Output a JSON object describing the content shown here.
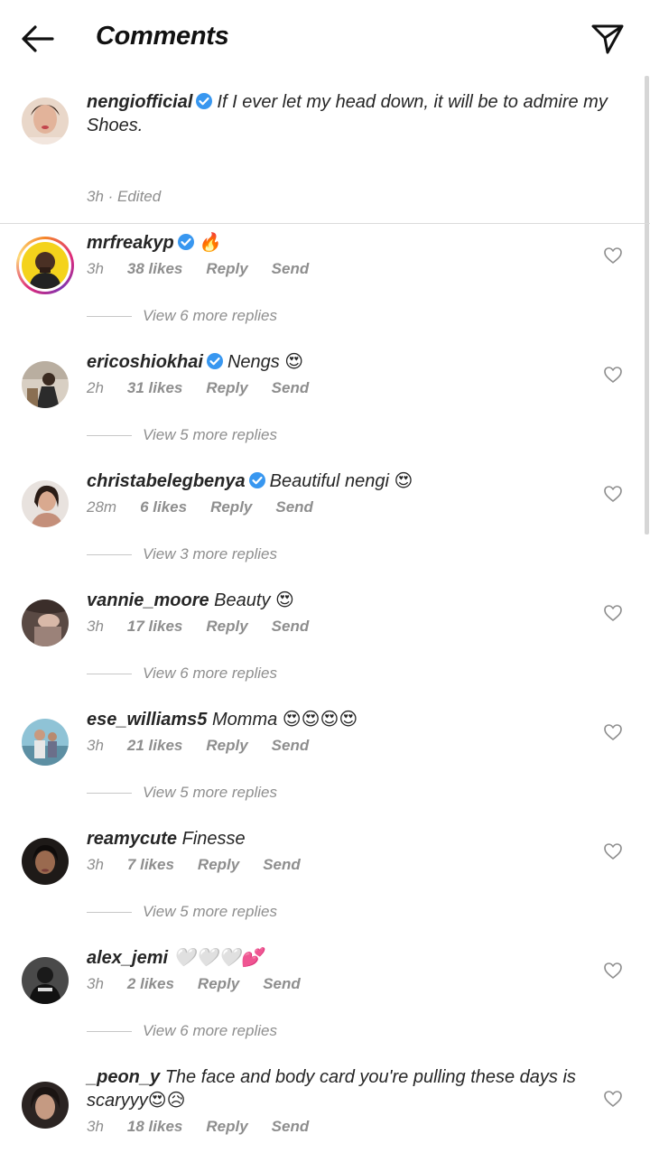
{
  "header": {
    "title": "Comments"
  },
  "caption": {
    "username": "nengiofficial",
    "text": "If I ever let my head down, it will be to admire my Shoes.",
    "meta": "3h · Edited"
  },
  "comments": [
    {
      "username": "mrfreakyp",
      "verified": true,
      "text": "🔥",
      "time": "3h",
      "likes": "38 likes",
      "reply": "Reply",
      "send": "Send",
      "more": "View 6 more replies"
    },
    {
      "username": "ericoshiokhai",
      "verified": true,
      "text": "Nengs 😍",
      "time": "2h",
      "likes": "31 likes",
      "reply": "Reply",
      "send": "Send",
      "more": "View 5 more replies"
    },
    {
      "username": "christabelegbenya",
      "verified": true,
      "text": "Beautiful nengi 😍",
      "time": "28m",
      "likes": "6 likes",
      "reply": "Reply",
      "send": "Send",
      "more": "View 3 more replies"
    },
    {
      "username": "vannie_moore",
      "verified": false,
      "text": "Beauty 😍",
      "time": "3h",
      "likes": "17 likes",
      "reply": "Reply",
      "send": "Send",
      "more": "View 6 more replies"
    },
    {
      "username": "ese_williams5",
      "verified": false,
      "text": "Momma 😍😍😍😍",
      "time": "3h",
      "likes": "21 likes",
      "reply": "Reply",
      "send": "Send",
      "more": "View 5 more replies"
    },
    {
      "username": "reamycute",
      "verified": false,
      "text": "Finesse",
      "time": "3h",
      "likes": "7 likes",
      "reply": "Reply",
      "send": "Send",
      "more": "View 5 more replies"
    },
    {
      "username": "alex_jemi",
      "verified": false,
      "text": "🤍🤍🤍💕",
      "time": "3h",
      "likes": "2 likes",
      "reply": "Reply",
      "send": "Send",
      "more": "View 6 more replies"
    },
    {
      "username": "_peon_y",
      "verified": false,
      "text": "The face and body card you're pulling these days is scaryyy😍😥",
      "time": "3h",
      "likes": "18 likes",
      "reply": "Reply",
      "send": "Send",
      "more": ""
    }
  ]
}
